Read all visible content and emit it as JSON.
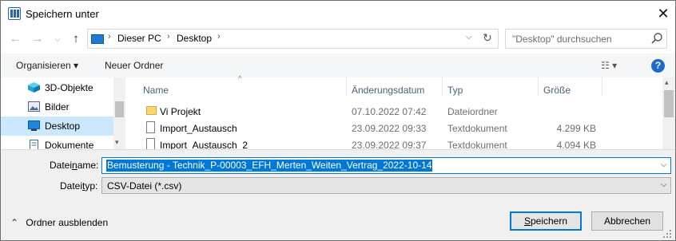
{
  "window": {
    "title": "Speichern unter",
    "close_glyph": "✕"
  },
  "nav": {
    "back_glyph": "←",
    "forward_glyph": "→",
    "up_glyph": "↑"
  },
  "address": {
    "crumbs": [
      "Dieser PC",
      "Desktop"
    ],
    "sep": "›",
    "refresh_glyph": "↻",
    "chevron_glyph": "⌵"
  },
  "search": {
    "placeholder": "\"Desktop\" durchsuchen"
  },
  "toolbar": {
    "organize": "Organisieren ▾",
    "new_folder": "Neuer Ordner",
    "view_glyph": "☷ ▾",
    "help_glyph": "?"
  },
  "sidebar": {
    "items": [
      {
        "label": "3D-Objekte",
        "icon": "3d-objects-icon"
      },
      {
        "label": "Bilder",
        "icon": "pictures-icon"
      },
      {
        "label": "Desktop",
        "icon": "desktop-icon",
        "selected": true
      },
      {
        "label": "Dokumente",
        "icon": "documents-icon"
      }
    ]
  },
  "files": {
    "sort_glyph": "^",
    "columns": [
      "Name",
      "Änderungsdatum",
      "Typ",
      "Größe"
    ],
    "rows": [
      {
        "name": "Vi Projekt",
        "date": "07.10.2022 07:42",
        "type": "Dateiordner",
        "size": "",
        "icon": "folder-icon"
      },
      {
        "name": "Import_Austausch",
        "date": "23.09.2022 09:33",
        "type": "Textdokument",
        "size": "4.299 KB",
        "icon": "text-file-icon"
      },
      {
        "name": "Import_Austausch_2",
        "date": "23.09.2022 09:37",
        "type": "Textdokument",
        "size": "4.094 KB",
        "icon": "text-file-icon"
      }
    ]
  },
  "form": {
    "filename_label_pre": "Datei",
    "filename_label_key": "n",
    "filename_label_post": "ame:",
    "filename_value": "Bemusterung - Technik_P-00003_EFH_Merten_Weiten_Vertrag_2022-10-14",
    "filetype_label_pre": "Datei",
    "filetype_label_key": "t",
    "filetype_label_post": "yp:",
    "filetype_value": "CSV-Datei (*.csv)",
    "dropdown_glyph": "⌵"
  },
  "footer": {
    "hide_folders": "Ordner ausblenden",
    "hide_glyph": "⌃",
    "save_pre": "",
    "save_key": "S",
    "save_post": "peichern",
    "cancel": "Abbrechen"
  },
  "colors": {
    "accent": "#0078d7",
    "selection": "#cce8ff",
    "help": "#1c6bc9",
    "folder": "#f8d775"
  }
}
